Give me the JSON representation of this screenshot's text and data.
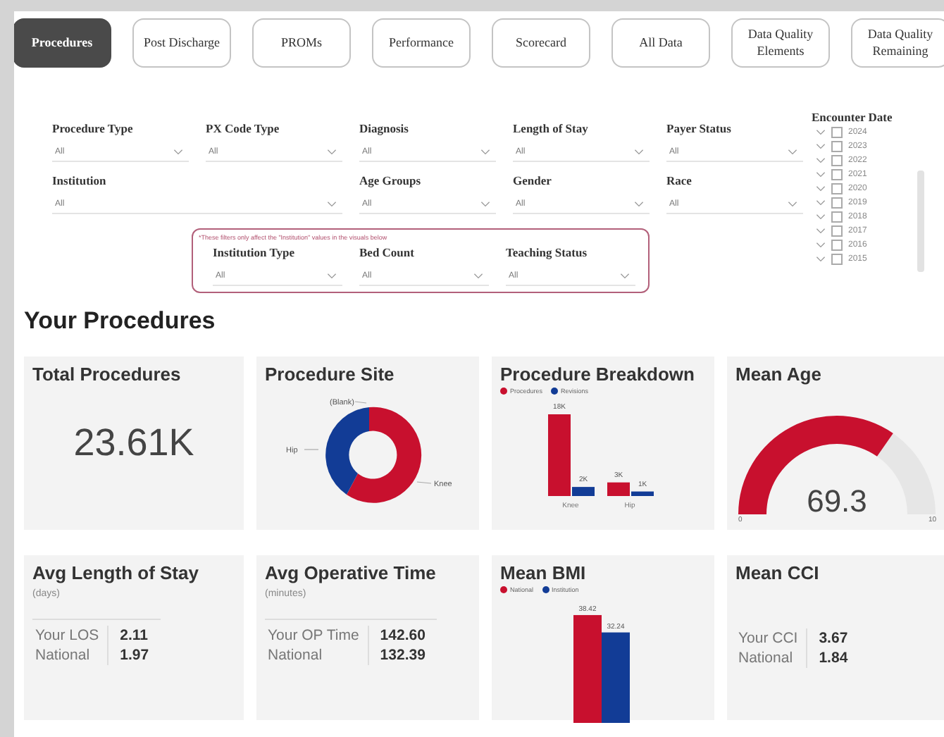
{
  "tabs": [
    {
      "label": "Procedures",
      "selected": true
    },
    {
      "label": "Post Discharge",
      "selected": false
    },
    {
      "label": "PROMs",
      "selected": false
    },
    {
      "label": "Performance",
      "selected": false
    },
    {
      "label": "Scorecard",
      "selected": false
    },
    {
      "label": "All Data",
      "selected": false
    },
    {
      "label": "Data Quality Elements",
      "selected": false
    },
    {
      "label": "Data Quality Remaining",
      "selected": false
    }
  ],
  "filter_rows": [
    [
      {
        "label": "Procedure Type",
        "value": "All"
      },
      {
        "label": "PX Code Type",
        "value": "All"
      },
      {
        "label": "Diagnosis",
        "value": "All"
      },
      {
        "label": "Length of Stay",
        "value": "All"
      },
      {
        "label": "Payer Status",
        "value": "All"
      }
    ],
    [
      {
        "label": "Institution",
        "value": "All"
      },
      {
        "label": "Age Groups",
        "value": "All"
      },
      {
        "label": "Gender",
        "value": "All"
      },
      {
        "label": "Race",
        "value": "All"
      }
    ]
  ],
  "scoped_filters": {
    "note": "*These filters only affect the \"Institution\" values in the visuals below",
    "filters": [
      {
        "label": "Institution Type",
        "value": "All"
      },
      {
        "label": "Bed Count",
        "value": "All"
      },
      {
        "label": "Teaching Status",
        "value": "All"
      }
    ]
  },
  "encounter_date": {
    "label": "Encounter Date",
    "years": [
      {
        "label": "2024",
        "checked": false
      },
      {
        "label": "2023",
        "checked": false
      },
      {
        "label": "2022",
        "checked": false
      },
      {
        "label": "2021",
        "checked": false
      },
      {
        "label": "2020",
        "checked": false
      },
      {
        "label": "2019",
        "checked": false
      },
      {
        "label": "2018",
        "checked": false
      },
      {
        "label": "2017",
        "checked": false
      },
      {
        "label": "2016",
        "checked": false
      },
      {
        "label": "2015",
        "checked": false
      }
    ]
  },
  "section_title": "Your Procedures",
  "cards": [
    {
      "kind": "kpi",
      "title": "Total Procedures",
      "value": "23.61K"
    },
    {
      "kind": "donut",
      "title": "Procedure Site",
      "slice_labels": [
        "(Blank)",
        "Hip",
        "Knee"
      ]
    },
    {
      "kind": "bar",
      "title": "Procedure Breakdown",
      "chart_data": {
        "type": "bar",
        "categories": [
          "Knee",
          "Hip"
        ],
        "series": [
          {
            "name": "Procedures",
            "color": "#c8102e",
            "values": [
              18000,
              3000
            ],
            "value_labels": [
              "18K",
              "3K"
            ]
          },
          {
            "name": "Revisions",
            "color": "#123c96",
            "values": [
              2000,
              1000
            ],
            "value_labels": [
              "2K",
              "1K"
            ]
          }
        ],
        "data_labels": true
      }
    },
    {
      "kind": "gauge",
      "title": "Mean Age",
      "value": "69.3",
      "min": "0",
      "max": "10"
    },
    {
      "kind": "compare",
      "title": "Avg Length of Stay",
      "subtitle": "(days)",
      "rows": [
        {
          "label": "Your LOS",
          "value": "2.11"
        },
        {
          "label": "National",
          "value": "1.97"
        }
      ]
    },
    {
      "kind": "compare",
      "title": "Avg Operative Time",
      "subtitle": "(minutes)",
      "rows": [
        {
          "label": "Your OP Time",
          "value": "142.60"
        },
        {
          "label": "National",
          "value": "132.39"
        }
      ]
    },
    {
      "kind": "bmi",
      "title": "Mean BMI",
      "chart_data": {
        "type": "bar",
        "series": [
          {
            "name": "National",
            "color": "#c8102e",
            "values": [
              38.42
            ]
          },
          {
            "name": "Institution",
            "color": "#123c96",
            "values": [
              32.24
            ]
          }
        ],
        "data_labels": true
      }
    },
    {
      "kind": "compare",
      "title": "Mean CCI",
      "rows": [
        {
          "label": "Your CCI",
          "value": "3.67"
        },
        {
          "label": "National",
          "value": "1.84"
        }
      ]
    }
  ]
}
